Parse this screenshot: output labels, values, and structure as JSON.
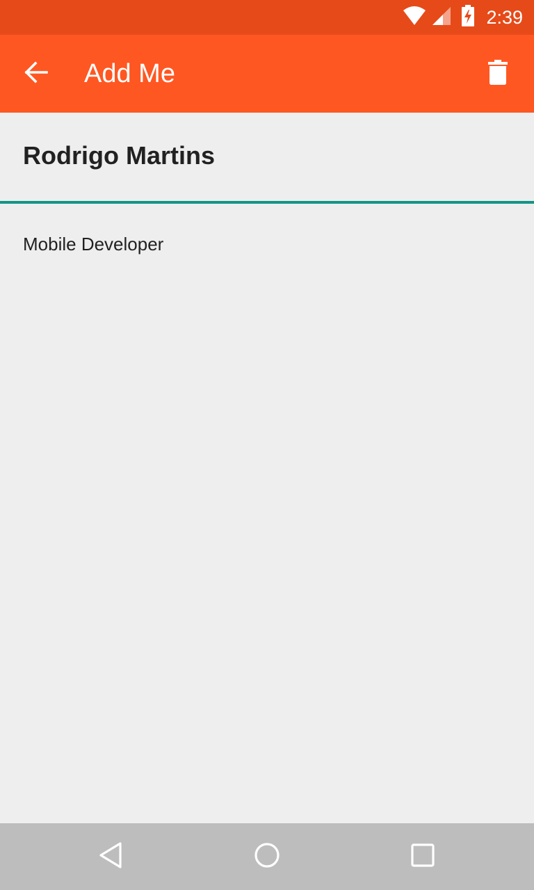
{
  "status_bar": {
    "time": "2:39",
    "icons": [
      "wifi-icon",
      "signal-icon",
      "battery-charging-icon"
    ]
  },
  "app_bar": {
    "title": "Add Me",
    "back_icon": "arrow-back-icon",
    "delete_icon": "trash-icon",
    "color": "#ff5722"
  },
  "content": {
    "name_value": "Rodrigo Martins",
    "role_value": "Mobile Developer",
    "accent_color": "#139588"
  },
  "nav_bar": {
    "icons": [
      "back-triangle-icon",
      "home-circle-icon",
      "recents-square-icon"
    ]
  }
}
